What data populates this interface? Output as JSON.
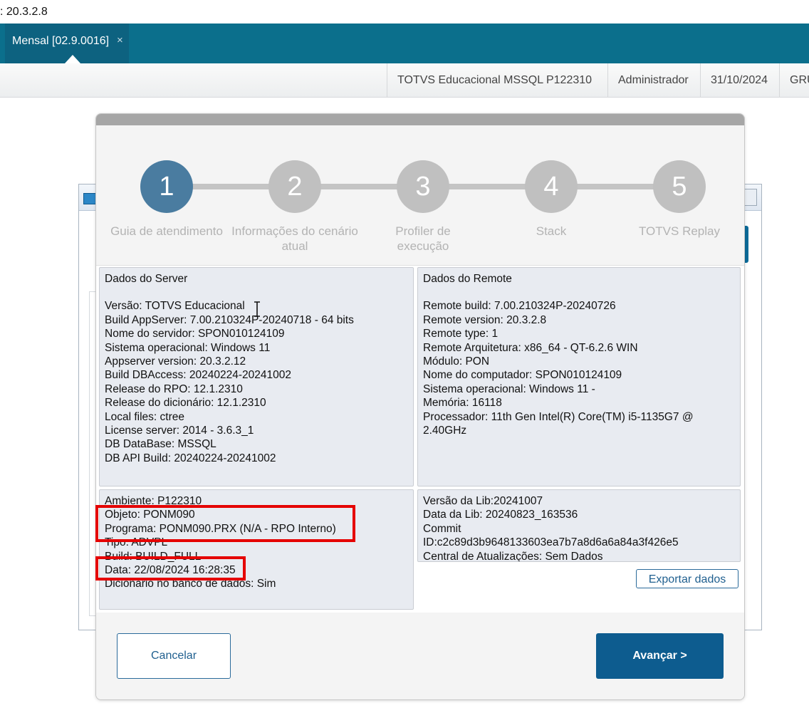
{
  "version_line": ": 20.3.2.8",
  "tab": {
    "label": "Mensal [02.9.0016]",
    "close": "×"
  },
  "status": {
    "environment": "TOTVS Educacional MSSQL P122310",
    "user": "Administrador",
    "date": "31/10/2024",
    "group": "GRU"
  },
  "steps": [
    {
      "number": "1",
      "label": "Guia de atendimento"
    },
    {
      "number": "2",
      "label": "Informações do cenário atual"
    },
    {
      "number": "3",
      "label": "Profiler de execução"
    },
    {
      "number": "4",
      "label": "Stack"
    },
    {
      "number": "5",
      "label": "TOTVS Replay"
    }
  ],
  "server": {
    "title": "Dados do Server",
    "lines": [
      "Versão: TOTVS Educacional",
      "Build AppServer: 7.00.210324P-20240718 - 64 bits",
      "Nome do servidor: SPON010124109",
      "Sistema operacional: Windows 11",
      "Appserver version: 20.3.2.12",
      "Build DBAccess: 20240224-20241002",
      "Release do RPO:  12.1.2310",
      "Release do dicionário: 12.1.2310",
      "Local files: ctree",
      "License server: 2014 - 3.6.3_1",
      "DB DataBase: MSSQL",
      "DB API Build: 20240224-20241002"
    ]
  },
  "remote": {
    "title": "Dados do Remote",
    "lines": [
      "Remote build: 7.00.210324P-20240726",
      "Remote version: 20.3.2.8",
      "Remote type: 1",
      "Remote Arquitetura: x86_64 - QT-6.2.6 WIN",
      "Módulo: PON",
      "Nome do computador: SPON010124109",
      "Sistema operacional: Windows 11 -",
      "Memória: 16118",
      "Processador: 11th Gen Intel(R) Core(TM) i5-1135G7 @ 2.40GHz"
    ]
  },
  "program": {
    "lines": [
      "Ambiente: P122310",
      "Objeto: PONM090",
      "Programa: PONM090.PRX (N/A - RPO Interno)",
      "Tipo: ADVPL",
      "Build: BUILD_FULL",
      "Data: 22/08/2024 16:28:35",
      "Dicionário no banco de dados: Sim"
    ]
  },
  "lib": {
    "lines": [
      "Versão da Lib:20241007",
      "Data da Lib: 20240823_163536",
      "Commit",
      "ID:c2c89d3b9648133603ea7b7a8d6a6a84a3f426e5",
      "Central de Atualizações: Sem Dados"
    ]
  },
  "buttons": {
    "export": "Exportar dados",
    "cancel": "Cancelar",
    "next": "Avançar >"
  },
  "colors": {
    "tabbar": "#0b6f8c",
    "active_step": "#4a7ca0",
    "inactive_step": "#c0c0c0",
    "primary_button": "#0d5c8f",
    "highlight": "#e50000"
  }
}
